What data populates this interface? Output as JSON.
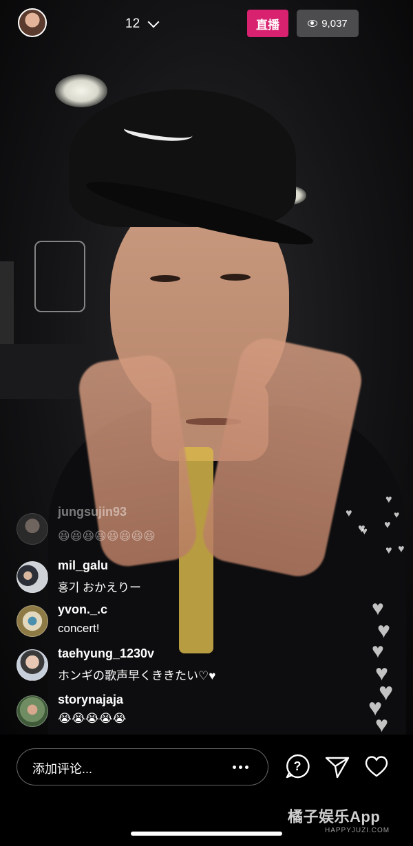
{
  "topbar": {
    "count": "12",
    "live_label": "直播",
    "viewer_count": "9,037"
  },
  "comments": [
    {
      "username": "jungsujin93",
      "text": "😆😆😆😆😆😆😆😆",
      "avatar_color": "#6b6b6b"
    },
    {
      "username": "mil_galu",
      "text": "홍기 おかえりー",
      "avatar_color": "#8a8f96"
    },
    {
      "username": "yvon._.c",
      "text": "concert!",
      "avatar_color": "#a48f5a"
    },
    {
      "username": "taehyung_1230v",
      "text": "ホンギの歌声早くききたい♡♥",
      "avatar_color": "#b3b8c2"
    },
    {
      "username": "storynajaja",
      "text": "😭😭😭😭😭",
      "avatar_color": "#5a7a52"
    }
  ],
  "bottom": {
    "comment_placeholder": "添加评论..."
  },
  "icons": [
    "chevron-down-icon",
    "eye-icon",
    "more-icon",
    "question-icon",
    "send-icon",
    "heart-icon"
  ],
  "watermark": {
    "main": "橘子娱乐App",
    "sub": "HAPPYJUZI.COM"
  },
  "colors": {
    "live": "#d8216f",
    "viewer_bg": "#4c4c4e"
  }
}
